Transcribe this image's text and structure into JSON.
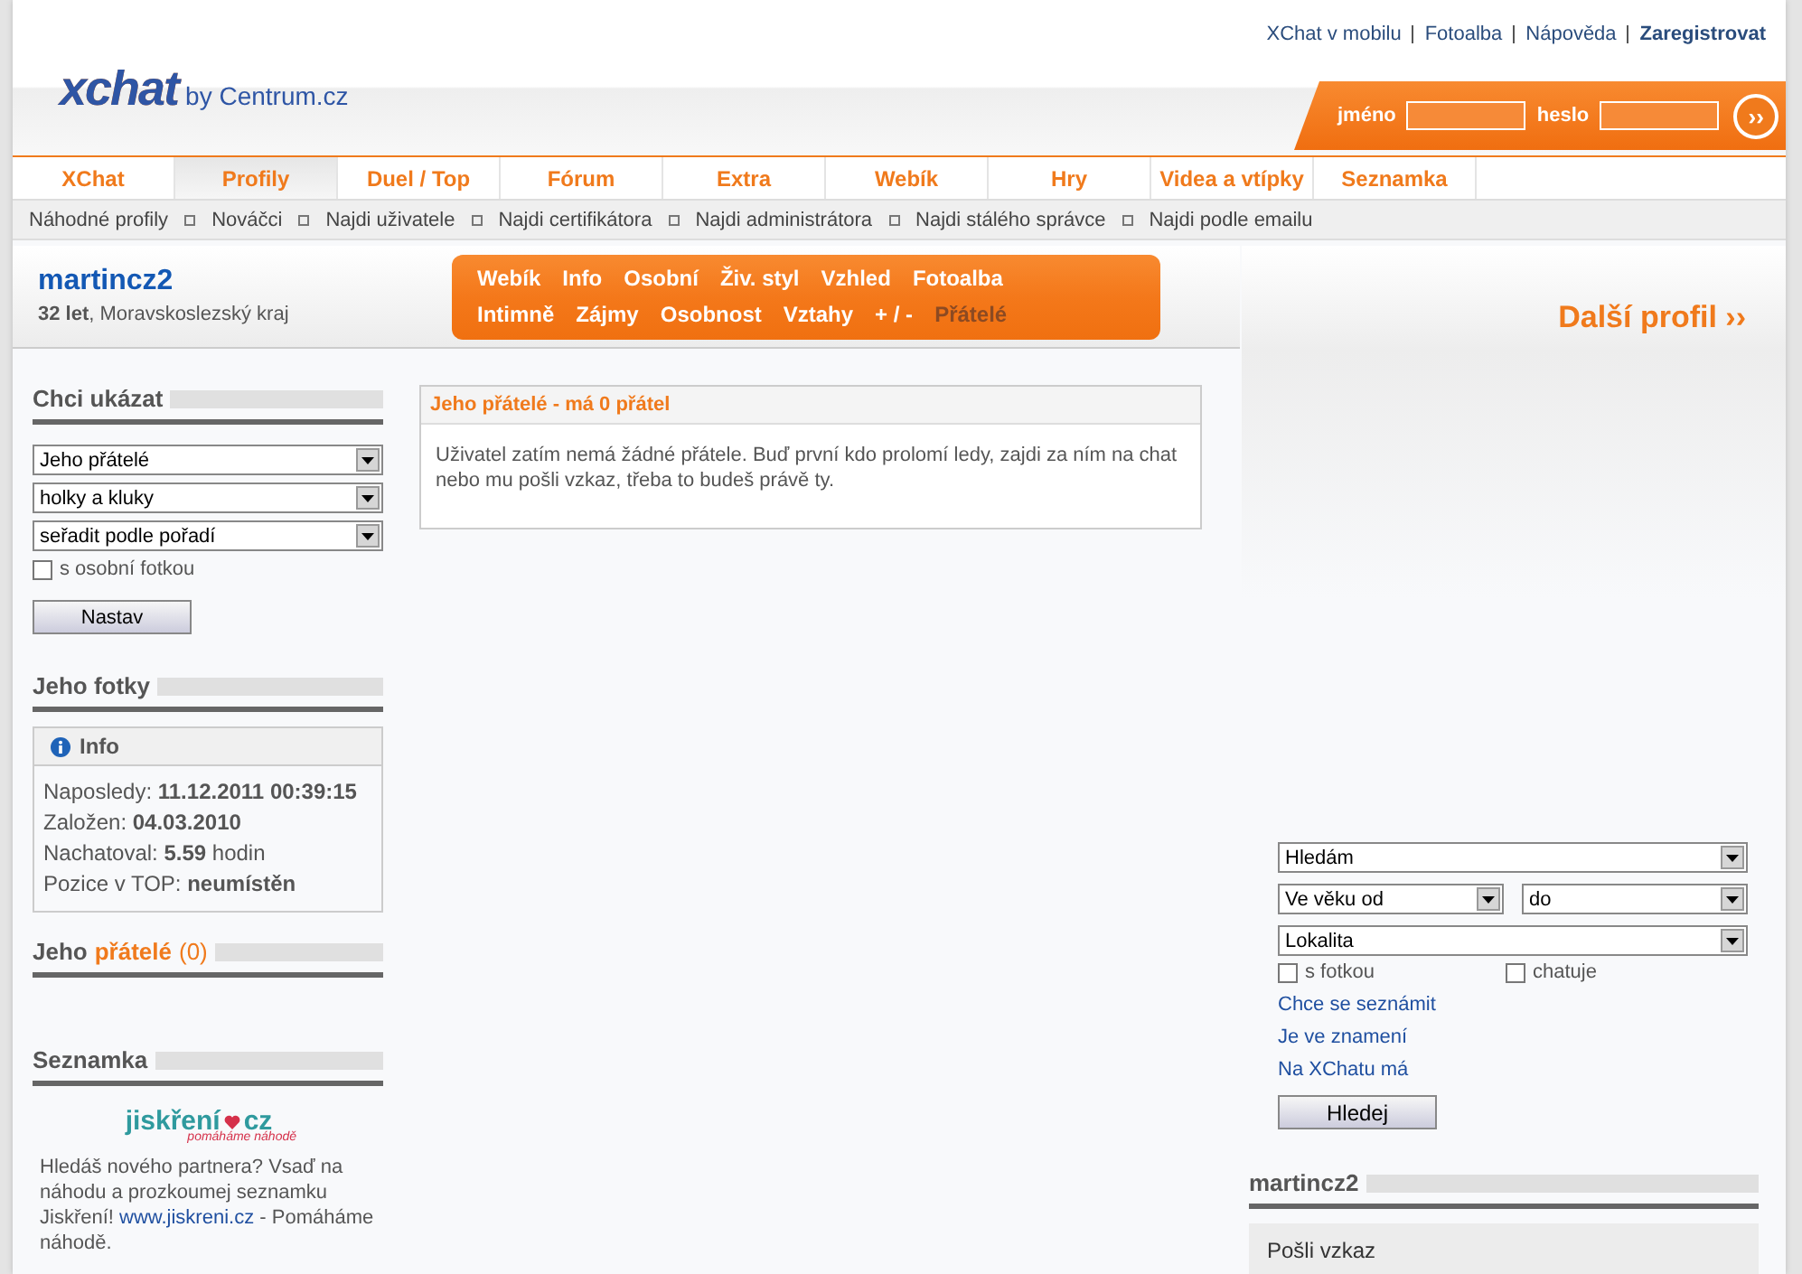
{
  "top_links": [
    {
      "label": "XChat v mobilu",
      "kind": "link"
    },
    {
      "label": "Fotoalba",
      "kind": "link"
    },
    {
      "label": "Nápověda",
      "kind": "link"
    },
    {
      "label": "Zaregistrovat",
      "kind": "strong"
    }
  ],
  "logo": {
    "brand": "xchat",
    "by": "by Centrum.cz"
  },
  "login": {
    "name_label": "jméno",
    "password_label": "heslo",
    "submit": "››"
  },
  "nav_tabs": [
    {
      "label": "XChat",
      "selected": false
    },
    {
      "label": "Profily",
      "selected": true
    },
    {
      "label": "Duel / Top",
      "selected": false
    },
    {
      "label": "Fórum",
      "selected": false
    },
    {
      "label": "Extra",
      "selected": false
    },
    {
      "label": "Webík",
      "selected": false
    },
    {
      "label": "Hry",
      "selected": false
    },
    {
      "label": "Videa a vtípky",
      "selected": false
    },
    {
      "label": "Seznamka",
      "selected": false
    }
  ],
  "sub_nav": [
    "Náhodné profily",
    "Nováčci",
    "Najdi uživatele",
    "Najdi certifikátora",
    "Najdi administrátora",
    "Najdi stálého správce",
    "Najdi podle emailu"
  ],
  "profile": {
    "name": "martincz2",
    "details": "**32 let**, Moravskoslezský kraj"
  },
  "profile_menu": [
    [
      {
        "label": "Webík",
        "selected": false
      },
      {
        "label": "Info",
        "selected": false
      },
      {
        "label": "Osobní",
        "selected": false
      },
      {
        "label": "Živ. styl",
        "selected": false
      },
      {
        "label": "Vzhled",
        "selected": false
      },
      {
        "label": "Fotoalba",
        "selected": false
      }
    ],
    [
      {
        "label": "Intimně",
        "selected": false
      },
      {
        "label": "Zájmy",
        "selected": false
      },
      {
        "label": "Osobnost",
        "selected": false
      },
      {
        "label": "Vztahy",
        "selected": false
      },
      {
        "label": "+ / -",
        "selected": false
      },
      {
        "label": "Přátelé",
        "selected": true
      }
    ]
  ],
  "next_profile": "Další profil ››",
  "filter": {
    "title": "Chci ukázat",
    "selects": [
      "Jeho přátelé",
      "holky a kluky",
      "seřadit podle pořadí"
    ],
    "checkbox": {
      "label": "s osobní fotkou",
      "checked": false
    },
    "button": "Nastav"
  },
  "photos_title": "Jeho fotky",
  "info": {
    "title": "Info",
    "lines": [
      "Naposledy: **11.12.2011 00:39:15**",
      "Založen: **04.03.2010**",
      "Nachatoval: **5.59** hodin",
      "Pozice v TOP: **neumístěn**"
    ]
  },
  "friends_title": {
    "prefix": "Jeho",
    "highlight": "přátelé",
    "count": "(0)"
  },
  "dating": {
    "title": "Seznamka",
    "logo_name": "jiskření",
    "logo_tld": "cz",
    "logo_tagline": "pomáháme náhodě",
    "text": "Hledáš nového partnera? Vsaď na náhodu a prozkoumej seznamku Jiskření!",
    "link": "www.jiskreni.cz",
    "tail": " - Pomáháme náhodě."
  },
  "panel": {
    "title": "Jeho přátelé - má 0 přátel",
    "text": "Uživatel zatím nemá žádné přátele. Buď první kdo prolomí ledy, zajdi za ním na chat nebo mu pošli vzkaz, třeba to budeš právě ty."
  },
  "search": {
    "looking_for": "Hledám",
    "age_from": "Ve věku od",
    "age_to": "do",
    "location": "Lokalita",
    "checkboxes": [
      {
        "label": "s fotkou",
        "checked": false
      },
      {
        "label": "chatuje",
        "checked": false
      }
    ],
    "links": [
      "Chce se seznámit",
      "Je ve znamení",
      "Na XChatu má"
    ],
    "button": "Hledej"
  },
  "user_box": {
    "title": "martincz2",
    "action": "Pošli vzkaz"
  }
}
